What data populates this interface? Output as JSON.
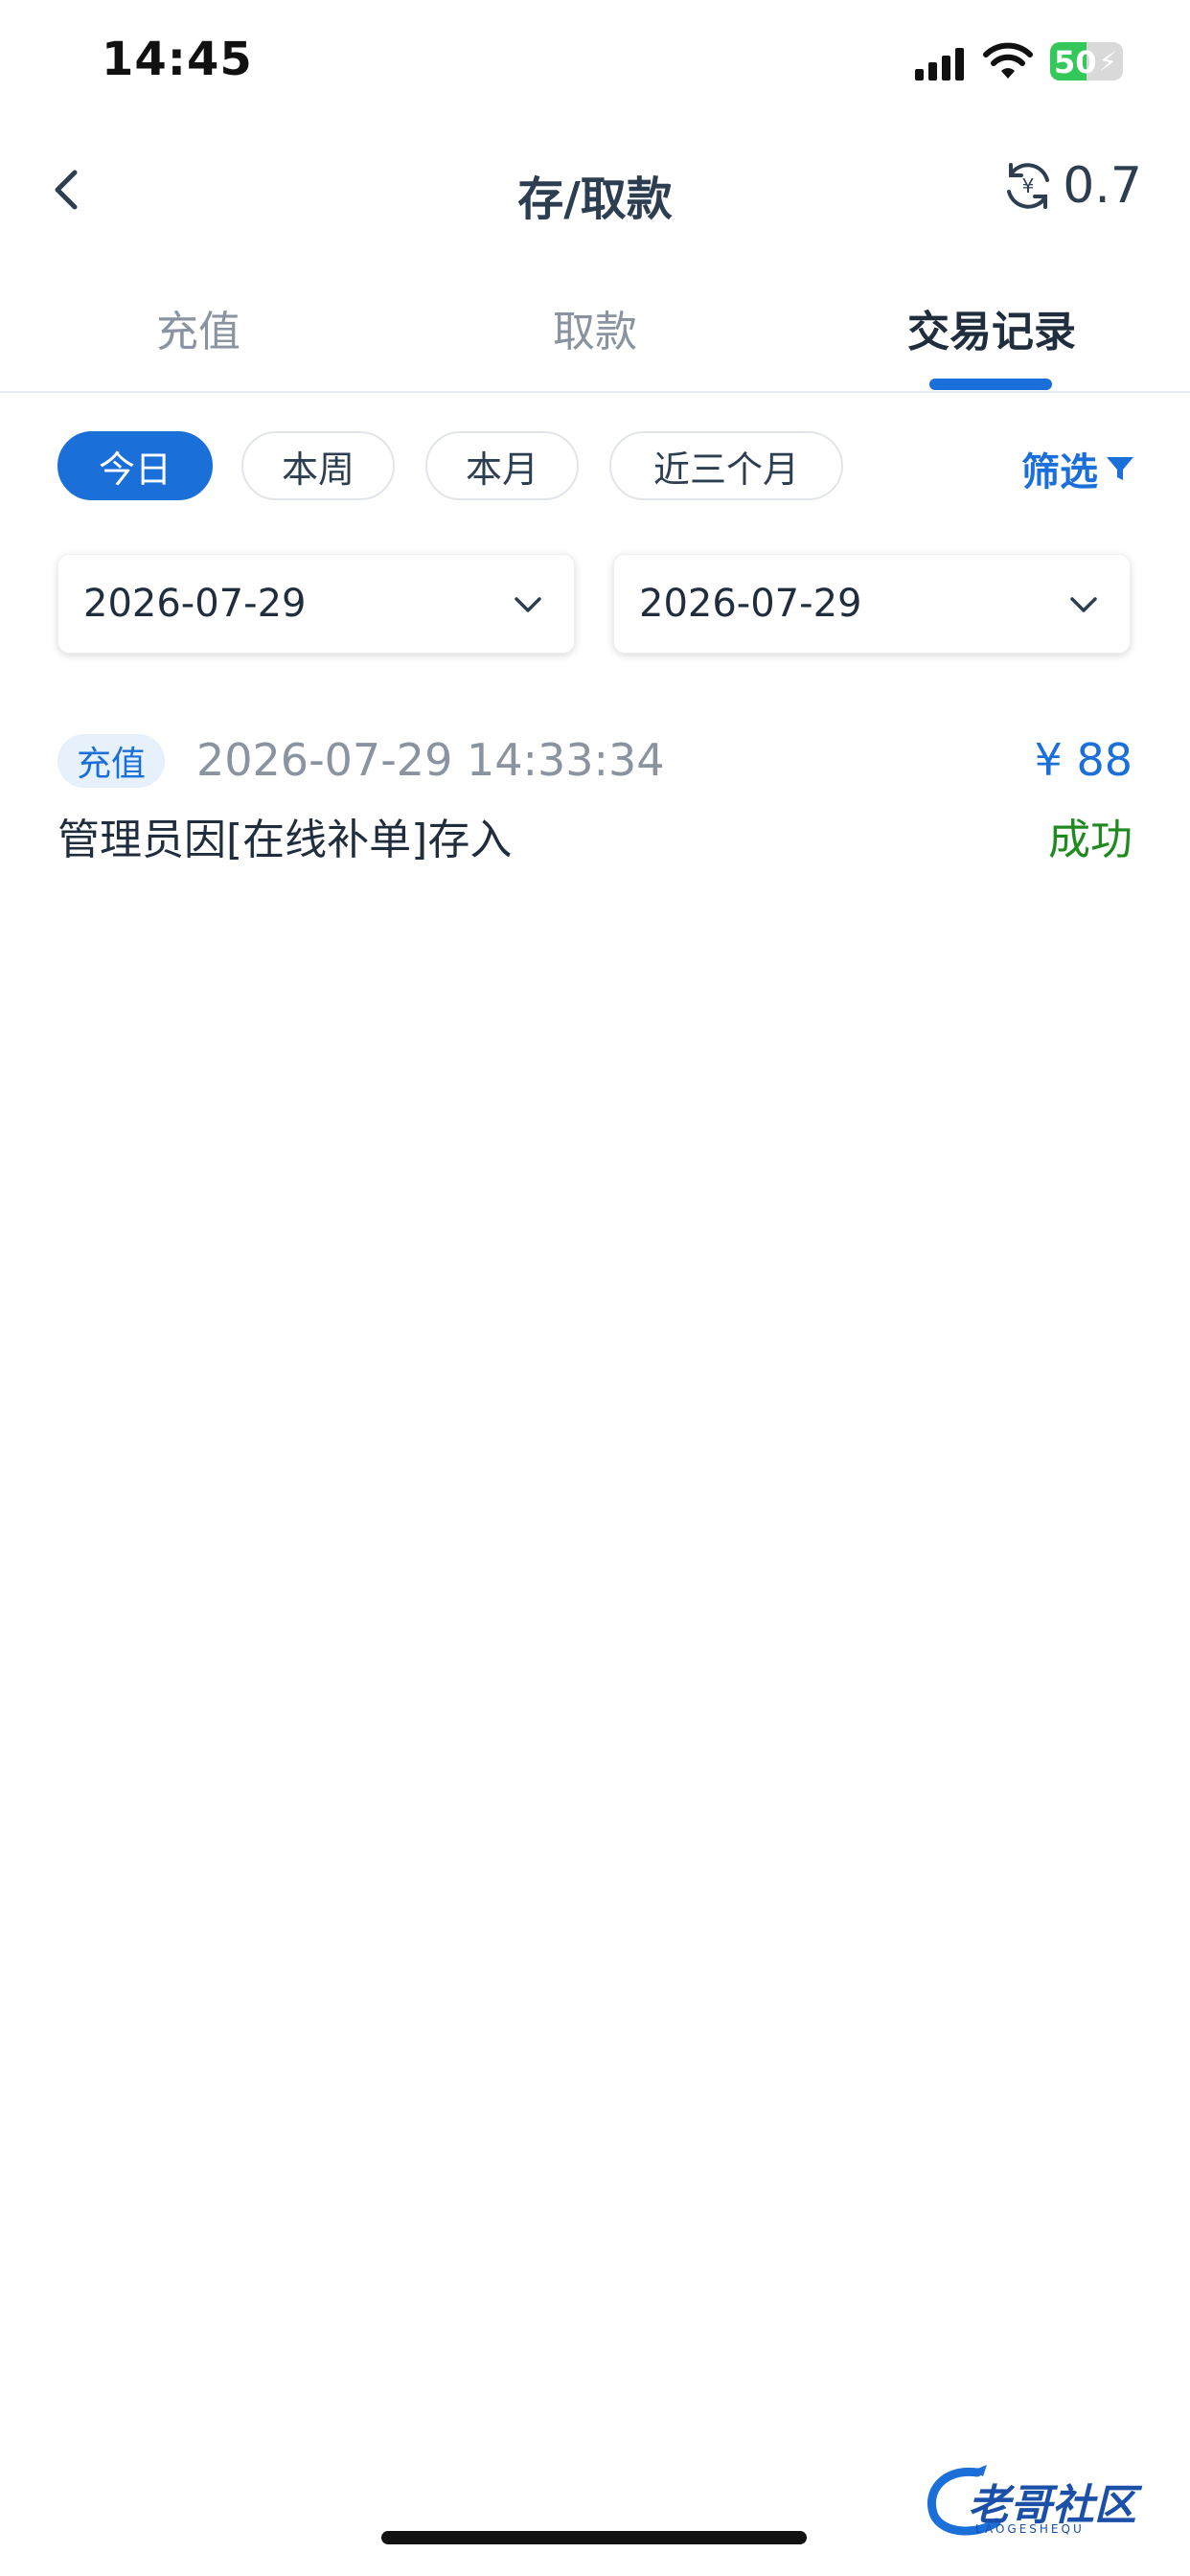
{
  "status_bar": {
    "time": "14:45",
    "battery_level": "50",
    "battery_fraction": 0.5
  },
  "nav": {
    "title": "存/取款",
    "balance": "0.7",
    "back_icon": "chevron-left-icon",
    "balance_icon": "yen-refresh-icon"
  },
  "tabs": [
    {
      "label": "充值"
    },
    {
      "label": "取款"
    },
    {
      "label": "交易记录"
    }
  ],
  "filters": {
    "chips": [
      {
        "label": "今日"
      },
      {
        "label": "本周"
      },
      {
        "label": "本月"
      },
      {
        "label": "近三个月"
      }
    ],
    "filter_label": "筛选"
  },
  "date_range": {
    "start": "2026-07-29",
    "end": "2026-07-29"
  },
  "records": [
    {
      "type": "充值",
      "time": "2026-07-29 14:33:34",
      "amount": "¥ 88",
      "description": "管理员因[在线补单]存入",
      "status": "成功"
    }
  ],
  "watermark": {
    "text": "老哥社区",
    "sub": "LAOGESHEQU"
  },
  "colors": {
    "accent": "#1b6fd8",
    "success": "#1f8a1f",
    "muted": "#8a93a0"
  }
}
